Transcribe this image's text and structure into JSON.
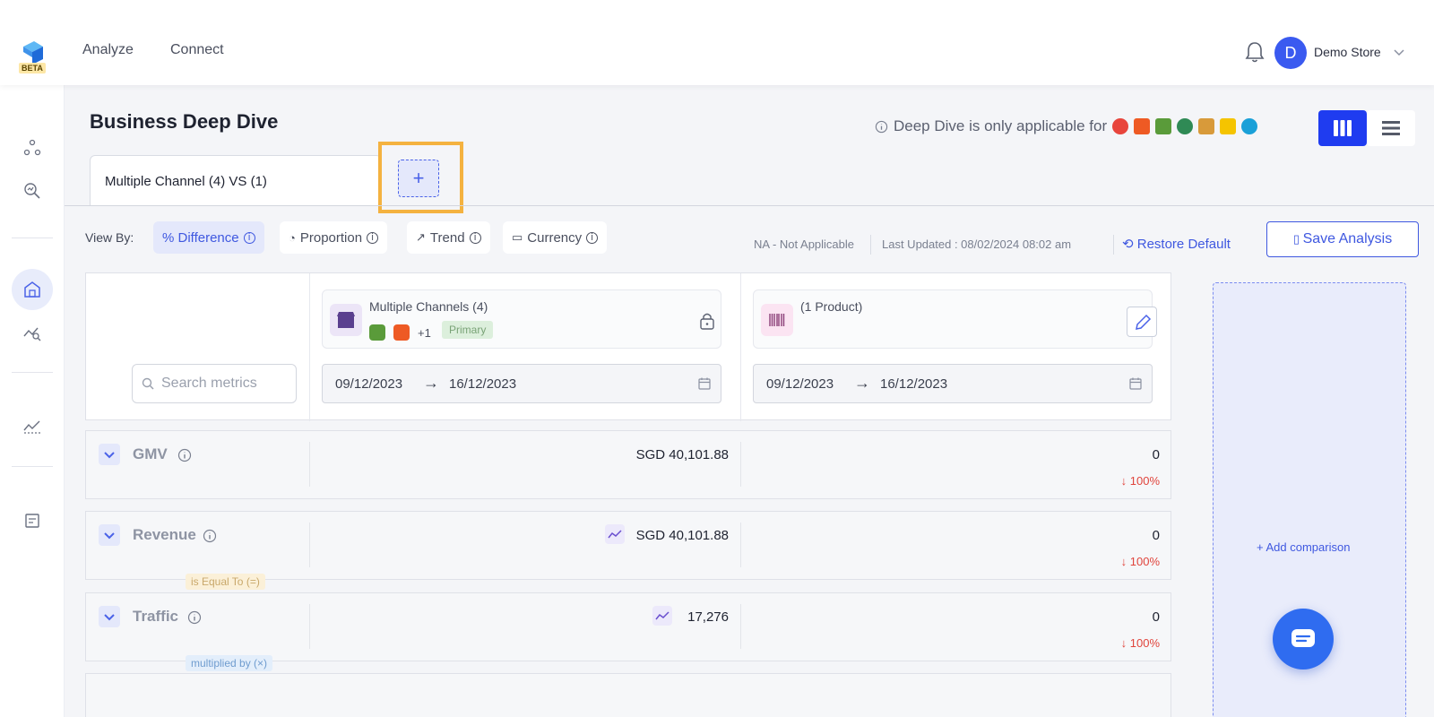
{
  "nav": {
    "beta_label": "BETA",
    "items": [
      {
        "label": "Analyze"
      },
      {
        "label": "Connect"
      }
    ],
    "user": {
      "initial": "D",
      "store_name": "Demo Store"
    }
  },
  "page": {
    "title": "Business Deep Dive",
    "notice": "Deep Dive is only applicable for",
    "tab_label": "Multiple Channel (4) VS (1)",
    "add_tab_symbol": "+"
  },
  "toolbar": {
    "view_by_label": "View By:",
    "view_options": [
      {
        "label": "% Difference",
        "active": true
      },
      {
        "label": "Proportion",
        "active": false
      },
      {
        "label": "Trend",
        "active": false
      },
      {
        "label": "Currency",
        "active": false
      }
    ],
    "na_text": "NA - Not Applicable",
    "last_updated": "Last Updated : 08/02/2024 08:02 am",
    "restore_label": "Restore Default",
    "save_label": "Save Analysis"
  },
  "comparison": {
    "search_placeholder": "Search metrics",
    "primary": {
      "title": "Multiple Channels (4)",
      "extra_count": "+1",
      "badge": "Primary",
      "date_from": "09/12/2023",
      "date_to": "16/12/2023"
    },
    "secondary": {
      "title": "(1 Product)",
      "date_from": "09/12/2023",
      "date_to": "16/12/2023"
    },
    "date_arrow": "→",
    "add_comparison_label": "Add comparison"
  },
  "metrics": [
    {
      "name": "GMV",
      "value_primary": "SGD 40,101.88",
      "value_secondary": "0",
      "change": "100%"
    },
    {
      "name": "Revenue",
      "value_primary": "SGD 40,101.88",
      "value_secondary": "0",
      "change": "100%"
    },
    {
      "name": "Traffic",
      "value_primary": "17,276",
      "value_secondary": "0",
      "change": "100%"
    }
  ],
  "operators": {
    "equal": "is Equal To (=)",
    "multiply": "multiplied by (×)"
  },
  "colors": {
    "accent": "#3f58e0",
    "highlight": "#f4b240",
    "negative": "#e0443c"
  }
}
